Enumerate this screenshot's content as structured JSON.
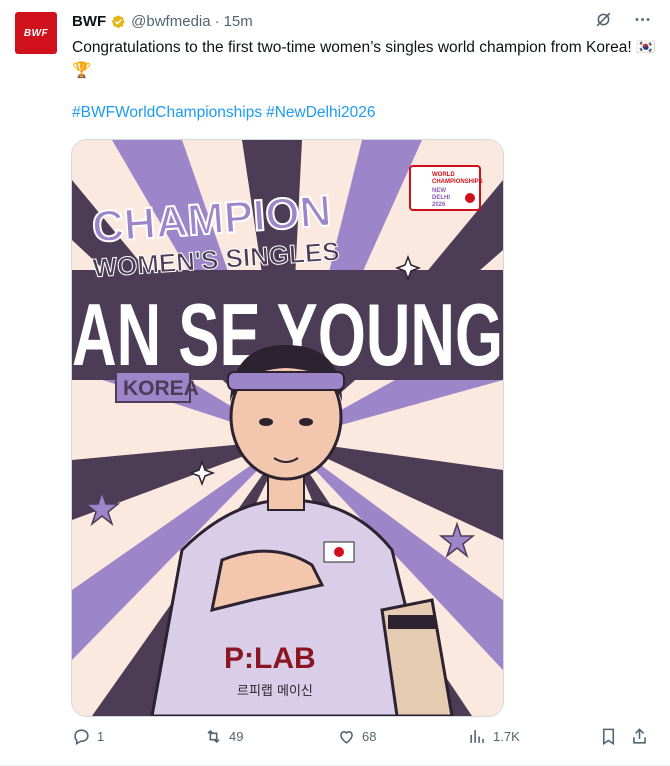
{
  "account": {
    "name": "BWF",
    "handle": "@bwfmedia",
    "separator": "·",
    "time": "15m",
    "avatar_text": "BWF"
  },
  "tweet": {
    "text": "Congratulations to the first two-time women’s singles world champion from Korea! 🇰🇷🏆",
    "hashtags": [
      "#BWFWorldChampionships",
      "#NewDelhi2026"
    ]
  },
  "image": {
    "champion": "CHAMPION",
    "event": "WOMEN'S SINGLES",
    "player_name": "AN SE YOUNG",
    "country": "KOREA",
    "badge_line1": "WORLD",
    "badge_line2": "CHAMPIONSHIPS",
    "badge_line3": "NEW",
    "badge_line4": "DELHI",
    "badge_line5": "2026",
    "sponsor": "P:LAB",
    "sponsor_korean": "르피랩 메이신"
  },
  "stats": {
    "replies": "1",
    "reposts": "49",
    "likes": "68",
    "views": "1.7K"
  },
  "colors": {
    "accent": "#1d9bf0",
    "brand": "#d0101a",
    "muted": "#536471",
    "purple": "#9c85c9",
    "dark_purple": "#4c3c55",
    "cream": "#fbe8de"
  },
  "icons": [
    "grok-icon",
    "more-icon",
    "reply-icon",
    "repost-icon",
    "like-icon",
    "views-icon",
    "bookmark-icon",
    "share-icon",
    "verified-badge-icon"
  ]
}
